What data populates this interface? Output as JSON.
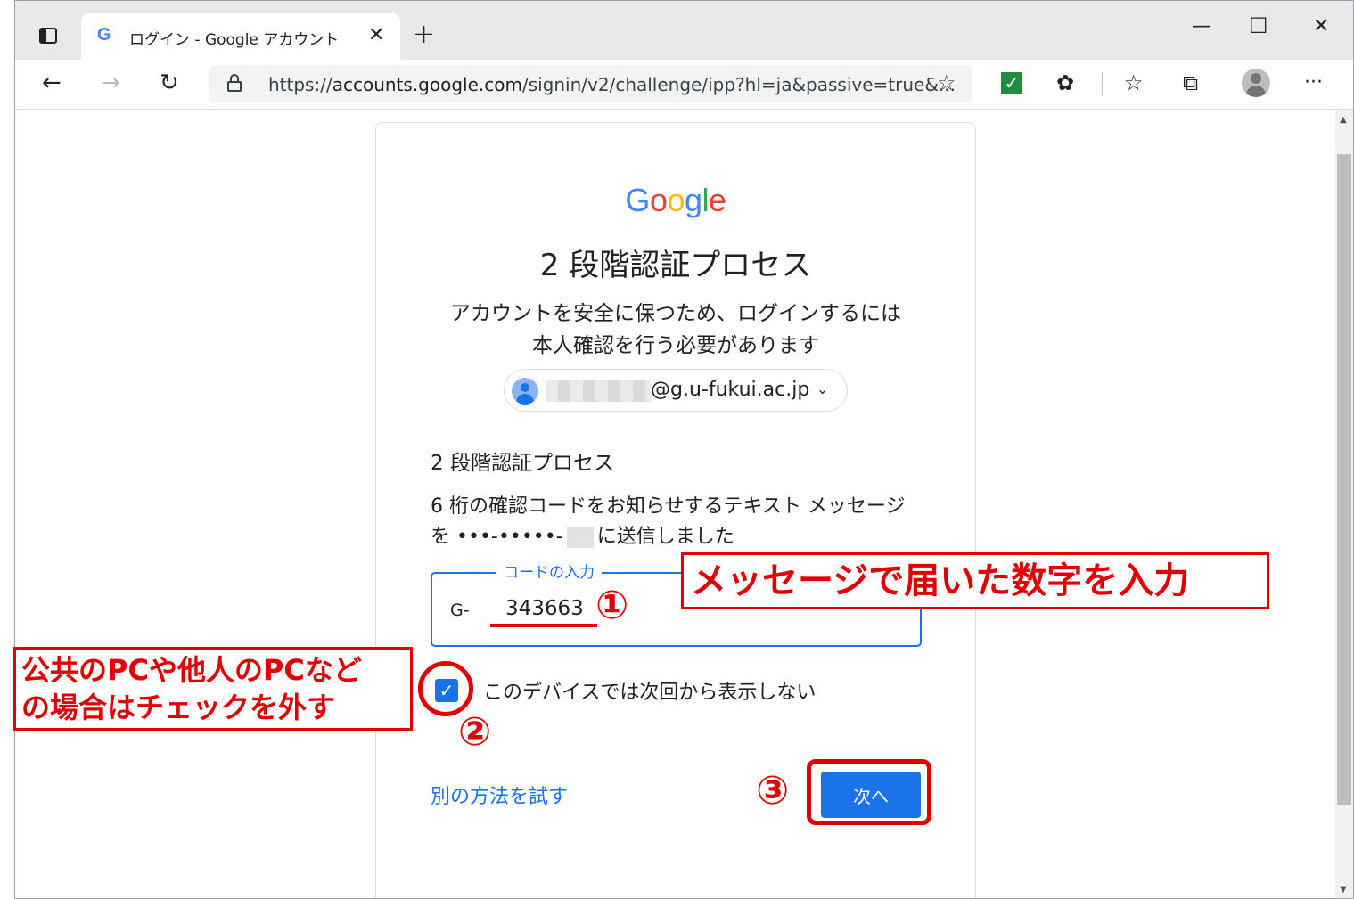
{
  "browser": {
    "tab_title": "ログイン - Google アカウント",
    "tab_favicon": "G",
    "url_prefix": "https://",
    "url_host": "accounts.google.com",
    "url_path": "/signin/v2/challenge/ipp?hl=ja&passive=true&...",
    "icons": [
      "tab-actions-icon",
      "back-icon",
      "forward-icon",
      "refresh-icon",
      "lock-icon",
      "add-favorite-icon",
      "extension-check-icon",
      "extensions-icon",
      "favorites-icon",
      "collections-icon",
      "profile-icon",
      "more-icon",
      "minimize-icon",
      "maximize-icon",
      "close-icon"
    ]
  },
  "page": {
    "logo": [
      "G",
      "o",
      "o",
      "g",
      "l",
      "e"
    ],
    "logo_colors": [
      "#4285f4",
      "#ea4335",
      "#fbbc05",
      "#4285f4",
      "#34a853",
      "#ea4335"
    ],
    "heading": "2 段階認証プロセス",
    "subtitle_line1": "アカウントを安全に保つため、ログインするには",
    "subtitle_line2": "本人確認を行う必要があります",
    "account_email": "@g.u-fukui.ac.jp",
    "section_title": "2 段階認証プロセス",
    "message_line1": "6 桁の確認コードをお知らせするテキスト メッセージ",
    "message_line2_prefix": "を •••-•••••-",
    "message_line2_suffix": "に送信しました",
    "code_field_label": "コードの入力",
    "code_prefix": "G-",
    "code_value": "343663",
    "remember_checked": true,
    "remember_label": "このデバイスでは次回から表示しない",
    "alt_method_link": "別の方法を試す",
    "next_button": "次へ"
  },
  "annotations": {
    "enter_code_note": "メッセージで届いた数字を入力",
    "public_pc_note_line1": "公共のPCや他人のPCなど",
    "public_pc_note_line2": "の場合はチェックを外す",
    "step1": "①",
    "step2": "②",
    "step3": "③"
  },
  "colors": {
    "accent": "#1a73e8",
    "annotation_red": "#e00000"
  }
}
